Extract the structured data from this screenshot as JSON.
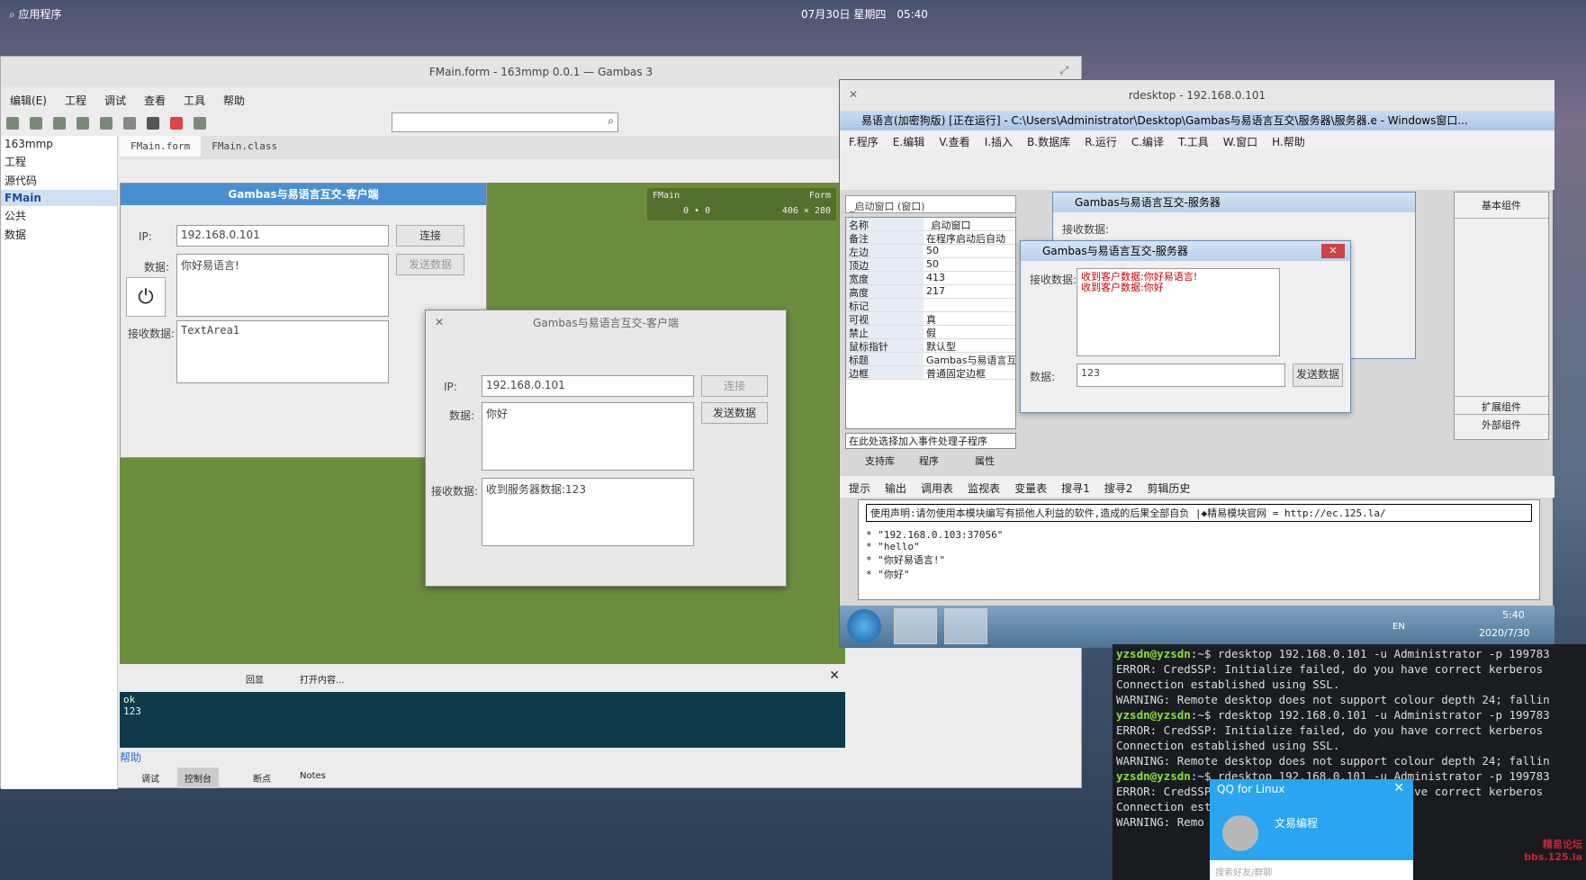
{
  "panel": {
    "apps_label": "应用程序",
    "datetime": "07月30日 星期四　05:40"
  },
  "gambas": {
    "title": "FMain.form - 163mmp 0.0.1 — Gambas 3",
    "menu": [
      "编辑(E)",
      "工程",
      "调试",
      "查看",
      "工具",
      "帮助"
    ],
    "tree": [
      "163mmp",
      "工程",
      "源代码",
      "FMain",
      "公共",
      "数据"
    ],
    "tabs": [
      "FMain.form",
      "FMain.class"
    ],
    "form_title": "Gambas与易语言互交-客户端",
    "ip_label": "IP:",
    "ip_value": "192.168.0.101",
    "connect": "连接",
    "data_label": "数据:",
    "data_value": "你好易语言!",
    "send": "发送数据",
    "recv_label": "接收数据:",
    "recv_value": "TextArea1",
    "fmain_info": {
      "name": "FMain",
      "kind": "Form",
      "pos": "0 • 0",
      "size": "406 × 280"
    },
    "console_lines": [
      "ok",
      "123"
    ],
    "help": "帮助",
    "bottom_tabs": [
      "调试",
      "控制台",
      "断点",
      "Notes"
    ],
    "console_toolbar": [
      "回显",
      "打开内容..."
    ]
  },
  "client": {
    "title": "Gambas与易语言互交-客户端",
    "ip_label": "IP:",
    "ip_value": "192.168.0.101",
    "connect": "连接",
    "data_label": "数据:",
    "data_value": "你好",
    "send": "发送数据",
    "recv_label": "接收数据:",
    "recv_value": "收到服务器数据:123"
  },
  "rdp": {
    "title": "rdesktop - 192.168.0.101",
    "ide_title": "易语言(加密狗版) [正在运行] - C:\\Users\\Administrator\\Desktop\\Gambas与易语言互交\\服务器\\服务器.e - Windows窗口...",
    "menu": [
      "F.程序",
      "E.编辑",
      "V.查看",
      "I.插入",
      "B.数据库",
      "R.运行",
      "C.编译",
      "T.工具",
      "W.窗口",
      "H.帮助"
    ],
    "combo": "_启动窗口 (窗口)",
    "props": [
      [
        "名称",
        "_启动窗口"
      ],
      [
        "备注",
        "在程序启动后自动"
      ],
      [
        "左边",
        "50"
      ],
      [
        "顶边",
        "50"
      ],
      [
        "宽度",
        "413"
      ],
      [
        "高度",
        "217"
      ],
      [
        "标记",
        ""
      ],
      [
        "可视",
        "真"
      ],
      [
        "禁止",
        "假"
      ],
      [
        "鼠标指针",
        "默认型"
      ],
      [
        "标题",
        "Gambas与易语言互"
      ],
      [
        "边框",
        "普通固定边框"
      ]
    ],
    "event_hint": "在此处选择加入事件处理子程序",
    "left_tabs": [
      "支持库",
      "程序",
      "属性"
    ],
    "server_back_title": "Gambas与易语言互交-服务器",
    "server_back_label": "接收数据:",
    "server_title": "Gambas与易语言互交-服务器",
    "server_recv_label": "接收数据:",
    "server_recv_lines": [
      "收到客户数据:你好易语言!",
      "收到客户数据:你好"
    ],
    "server_data_label": "数据:",
    "server_data_value": "123",
    "server_send": "发送数据",
    "components": [
      "基本组件",
      "扩展组件",
      "外部组件"
    ],
    "out_tabs": [
      "提示",
      "输出",
      "调用表",
      "监视表",
      "变量表",
      "搜寻1",
      "搜寻2",
      "剪辑历史"
    ],
    "out_notice": "使用声明:请勿使用本模块编写有损他人利益的软件,造成的后果全部自负 |◆精易模块官网 = http://ec.125.la/",
    "out_lines": [
      "* \"192.168.0.103:37056\"",
      "* \"hello\"",
      "* \"你好易语言!\"",
      "* \"你好\""
    ],
    "tray": {
      "lang": "EN",
      "time": "5:40",
      "date": "2020/7/30"
    }
  },
  "terminal": {
    "lines": [
      {
        "p": "yzsdn@yzsdn",
        "t": ":~$ rdesktop 192.168.0.101 -u Administrator -p 199783"
      },
      {
        "p": "",
        "t": "ERROR: CredSSP: Initialize failed, do you have correct kerberos"
      },
      {
        "p": "",
        "t": "Connection established using SSL."
      },
      {
        "p": "",
        "t": "WARNING: Remote desktop does not support colour depth 24; fallin"
      },
      {
        "p": "yzsdn@yzsdn",
        "t": ":~$ rdesktop 192.168.0.101 -u Administrator -p 199783"
      },
      {
        "p": "",
        "t": "ERROR: CredSSP: Initialize failed, do you have correct kerberos"
      },
      {
        "p": "",
        "t": "Connection established using SSL."
      },
      {
        "p": "",
        "t": "WARNING: Remote desktop does not support colour depth 24; fallin"
      },
      {
        "p": "yzsdn@yzsdn",
        "t": ":~$ rdesktop 192.168.0.101 -u Administrator -p 199783"
      },
      {
        "p": "",
        "t": "ERROR: CredSSP: Initialize failed, do you have correct kerberos"
      },
      {
        "p": "",
        "t": "Connection est"
      },
      {
        "p": "",
        "t": "WARNING: Remo"
      }
    ]
  },
  "qq": {
    "title": "QQ for Linux",
    "contact": "文易编程",
    "search": "搜索好友/群聊"
  },
  "watermark": "精易论坛 bbs.125.la"
}
